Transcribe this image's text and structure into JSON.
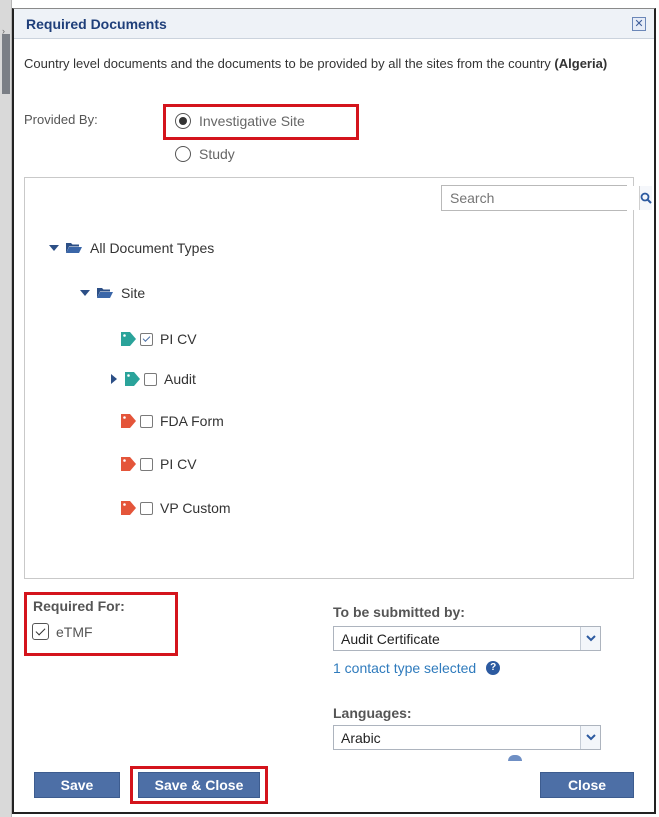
{
  "dialog": {
    "title": "Required Documents",
    "description_prefix": "Country level documents and the documents to be provided by all the sites from the country",
    "country": "(Algeria)"
  },
  "provided_by": {
    "label": "Provided By:",
    "options": [
      {
        "label": "Investigative Site",
        "selected": true
      },
      {
        "label": "Study",
        "selected": false
      }
    ]
  },
  "tree": {
    "search_placeholder": "Search",
    "root": "All Document Types",
    "site": "Site",
    "items": [
      {
        "label": "PI CV",
        "tag": "teal",
        "checked": true,
        "expandable": false
      },
      {
        "label": "Audit",
        "tag": "teal",
        "checked": false,
        "expandable": true
      },
      {
        "label": "FDA Form",
        "tag": "red",
        "checked": false,
        "expandable": false
      },
      {
        "label": "PI CV",
        "tag": "red",
        "checked": false,
        "expandable": false
      },
      {
        "label": "VP Custom",
        "tag": "red",
        "checked": false,
        "expandable": false
      }
    ]
  },
  "required_for": {
    "label": "Required For:",
    "option": "eTMF",
    "checked": true
  },
  "submitted_by": {
    "label": "To be submitted by:",
    "value": "Audit Certificate",
    "contact_link": "1 contact type selected"
  },
  "languages": {
    "label": "Languages:",
    "value": "Arabic"
  },
  "buttons": {
    "save": "Save",
    "save_close": "Save & Close",
    "close": "Close"
  },
  "colors": {
    "title": "#1f3f7a",
    "button": "#4d6fa6",
    "highlight": "#d4141c",
    "tag_teal": "#2aa39a",
    "tag_red": "#e4553a",
    "link": "#2f7bbd"
  }
}
